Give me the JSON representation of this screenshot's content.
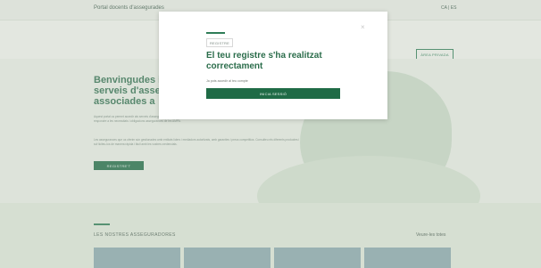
{
  "site": {
    "title": "Portal docents d'assegurades",
    "lang": "CA | ES",
    "header_button": "ÀREA PRIVADA"
  },
  "hero": {
    "heading": "Benvingudes i benvinguts al portal de serveis d'assegurances per a les associades a",
    "paragraph_1": "Aquest portal us permet accedir als serveis d'assegurances oferts per l'associació a les persones associades. Els productes estan adaptats al perfil dels docents per respondre a les necessitats i obligacions assegurances de les AMPA.",
    "paragraph_2": "Les assegurances que us oferim són gestionades amb entitats líders i mediadors autoritzats, amb garanties i preus competitius. Consulteu els diferents productes i sol·liciteu-los de manera ràpida i fàcil amb les vostres credencials.",
    "button": "REGISTRE'T"
  },
  "insurers": {
    "heading": "LES NOSTRES ASSEGURADORES",
    "see_all": "Veure-les totes"
  },
  "modal": {
    "label": "REGISTRE",
    "title": "El teu registre s'ha realitzat correctament",
    "hint": "Ja pots accedir al teu compte",
    "button": "INICIA SESSIÓ",
    "close_icon": "close-icon"
  },
  "colors": {
    "primary": "#1f6b46",
    "accent": "#2f7d57",
    "title": "#2b6d4b",
    "background": "#f6f7f3"
  }
}
